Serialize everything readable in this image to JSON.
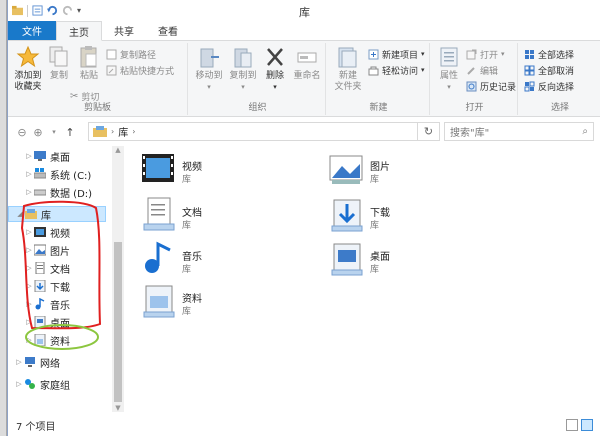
{
  "window": {
    "title": "库"
  },
  "tabs": [
    {
      "label": "文件"
    },
    {
      "label": "主页"
    },
    {
      "label": "共享"
    },
    {
      "label": "查看"
    }
  ],
  "ribbon": {
    "clipboard": {
      "label": "剪贴板",
      "pin_quick_access_line1": "添加到",
      "pin_quick_access_line2": "收藏夹",
      "copy": "复制",
      "paste": "粘贴",
      "copy_path": "复制路径",
      "paste_shortcut": "粘贴快捷方式",
      "cut": "剪切"
    },
    "organize": {
      "label": "组织",
      "move_to": "移动到",
      "copy_to": "复制到",
      "delete": "删除",
      "rename": "重命名"
    },
    "new": {
      "label": "新建",
      "new_folder_line1": "新建",
      "new_folder_line2": "文件夹",
      "new_item": "新建项目",
      "easy_access": "轻松访问"
    },
    "open": {
      "label": "打开",
      "properties": "属性",
      "open": "打开",
      "edit": "编辑",
      "history": "历史记录"
    },
    "select": {
      "label": "选择",
      "select_all": "全部选择",
      "select_none": "全部取消",
      "invert": "反向选择"
    }
  },
  "address": {
    "path": "库",
    "search_placeholder": "搜索\"库\""
  },
  "navpane": {
    "items": [
      {
        "label": "桌面",
        "icon": "desktop-icon"
      },
      {
        "label": "系统 (C:)",
        "icon": "drive-c-icon"
      },
      {
        "label": "数据 (D:)",
        "icon": "drive-d-icon"
      },
      {
        "label": "库",
        "icon": "library-icon"
      },
      {
        "label": "视频",
        "icon": "video-library-icon"
      },
      {
        "label": "图片",
        "icon": "picture-library-icon"
      },
      {
        "label": "文档",
        "icon": "document-library-icon"
      },
      {
        "label": "下载",
        "icon": "download-library-icon"
      },
      {
        "label": "音乐",
        "icon": "music-library-icon"
      },
      {
        "label": "桌面",
        "icon": "desktop-library-icon"
      },
      {
        "label": "资料",
        "icon": "materials-library-icon"
      },
      {
        "label": "网络",
        "icon": "network-icon"
      },
      {
        "label": "家庭组",
        "icon": "homegroup-icon"
      }
    ]
  },
  "content": {
    "items": [
      {
        "name": "视频",
        "type": "库",
        "icon": "video-library-icon"
      },
      {
        "name": "图片",
        "type": "库",
        "icon": "picture-library-icon"
      },
      {
        "name": "文档",
        "type": "库",
        "icon": "document-library-icon"
      },
      {
        "name": "下载",
        "type": "库",
        "icon": "download-library-icon"
      },
      {
        "name": "音乐",
        "type": "库",
        "icon": "music-library-icon"
      },
      {
        "name": "桌面",
        "type": "库",
        "icon": "desktop-library-icon"
      },
      {
        "name": "资料",
        "type": "库",
        "icon": "materials-library-icon"
      }
    ]
  },
  "status": {
    "count": "7 个项目"
  },
  "colors": {
    "accent": "#1979ca",
    "selection": "#cce8ff",
    "annotation_red": "#e02020",
    "annotation_green": "#8cc63f"
  }
}
